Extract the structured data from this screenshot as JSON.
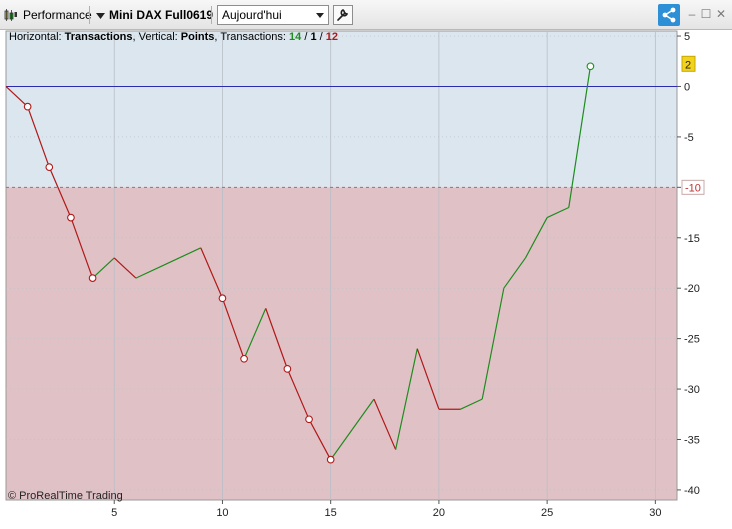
{
  "toolbar": {
    "title": "Performance",
    "instrument": "Mini DAX Full0619",
    "period": "Aujourd'hui",
    "icons": [
      "candlestick-icon",
      "chevron-down-icon",
      "wrench-icon",
      "share-icon"
    ],
    "window_controls": [
      "–",
      "☐",
      "✕"
    ]
  },
  "header": {
    "horizontal_label": "Horizontal: ",
    "horizontal_value": "Transactions",
    "vertical_label": ", Vertical: ",
    "vertical_value": "Points",
    "transactions_label": ", Transactions: ",
    "wins": "14",
    "sep1": " / ",
    "neutral": "1",
    "sep2": " / ",
    "losses": "12"
  },
  "watermark": "© ProRealTime Trading",
  "badges": {
    "current_value": "2",
    "threshold_value": "-10"
  },
  "colors": {
    "gain": "#1e8c1e",
    "loss": "#b01818",
    "upper_zone": "#dbe6ee",
    "lower_zone": "#e0c2c6",
    "zero_line": "#2b2bb0",
    "badge_current": "#f2d21c"
  },
  "chart_data": {
    "type": "line",
    "title": "",
    "xlabel": "",
    "ylabel": "",
    "xlim": [
      0,
      31
    ],
    "ylim": [
      -41,
      5.5
    ],
    "x_ticks": [
      5,
      10,
      15,
      20,
      25,
      30
    ],
    "y_ticks": [
      5,
      0,
      -5,
      -10,
      -15,
      -20,
      -25,
      -30,
      -35,
      -40
    ],
    "zero_line": 0,
    "threshold_line": -10,
    "grid": true,
    "series": [
      {
        "x": [
          0,
          1,
          2,
          3,
          4,
          5,
          6,
          7,
          8,
          9,
          10,
          11,
          12,
          13,
          14,
          15,
          16,
          17,
          18,
          19,
          20,
          21,
          22,
          23,
          24,
          25,
          26,
          27
        ],
        "values": [
          0,
          -2,
          -8,
          -13,
          -19,
          -17,
          -19,
          -18,
          -17,
          -16,
          -21,
          -27,
          -22,
          -28,
          -33,
          -37,
          -34,
          -31,
          -36,
          -26,
          -32,
          -32,
          -31,
          -20,
          -17,
          -13,
          -12,
          2
        ]
      }
    ],
    "markers_x": [
      1,
      2,
      3,
      4,
      10,
      11,
      13,
      14,
      15,
      27
    ]
  }
}
